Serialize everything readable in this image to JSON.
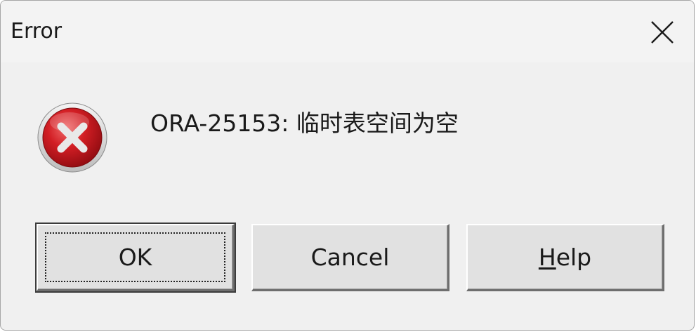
{
  "dialog": {
    "title": "Error",
    "message": "ORA-25153: 临时表空间为空",
    "icon": "error-icon",
    "close_icon": "close-icon"
  },
  "buttons": {
    "ok_label": "OK",
    "cancel_label": "Cancel",
    "help_mnemonic": "H",
    "help_rest": "elp"
  },
  "colors": {
    "error_red": "#c8141a",
    "dialog_bg": "#f0f0f0",
    "button_bg": "#e1e1e1"
  }
}
